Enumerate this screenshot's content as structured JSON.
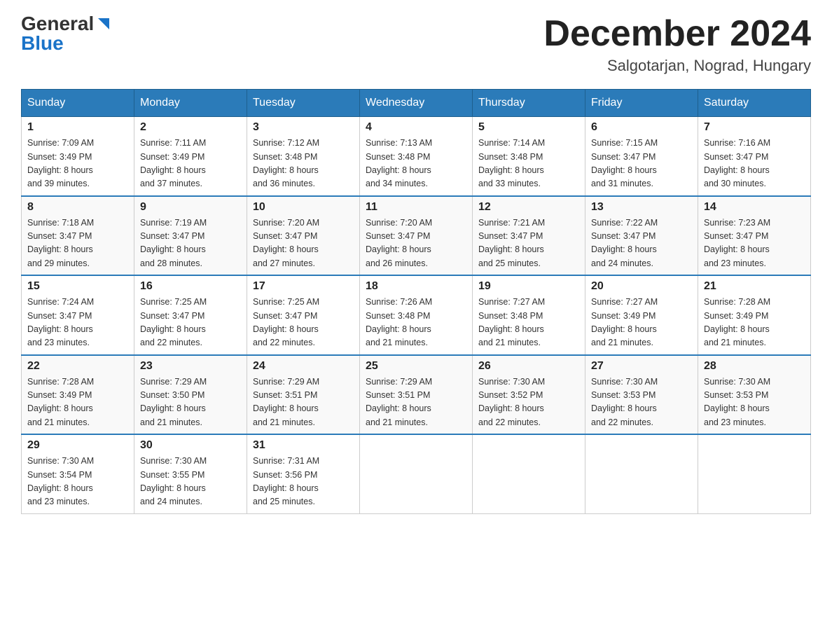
{
  "header": {
    "logo_general": "General",
    "logo_blue": "Blue",
    "month_title": "December 2024",
    "location": "Salgotarjan, Nograd, Hungary"
  },
  "weekdays": [
    "Sunday",
    "Monday",
    "Tuesday",
    "Wednesday",
    "Thursday",
    "Friday",
    "Saturday"
  ],
  "weeks": [
    [
      {
        "day": "1",
        "sunrise": "7:09 AM",
        "sunset": "3:49 PM",
        "daylight": "8 hours and 39 minutes."
      },
      {
        "day": "2",
        "sunrise": "7:11 AM",
        "sunset": "3:49 PM",
        "daylight": "8 hours and 37 minutes."
      },
      {
        "day": "3",
        "sunrise": "7:12 AM",
        "sunset": "3:48 PM",
        "daylight": "8 hours and 36 minutes."
      },
      {
        "day": "4",
        "sunrise": "7:13 AM",
        "sunset": "3:48 PM",
        "daylight": "8 hours and 34 minutes."
      },
      {
        "day": "5",
        "sunrise": "7:14 AM",
        "sunset": "3:48 PM",
        "daylight": "8 hours and 33 minutes."
      },
      {
        "day": "6",
        "sunrise": "7:15 AM",
        "sunset": "3:47 PM",
        "daylight": "8 hours and 31 minutes."
      },
      {
        "day": "7",
        "sunrise": "7:16 AM",
        "sunset": "3:47 PM",
        "daylight": "8 hours and 30 minutes."
      }
    ],
    [
      {
        "day": "8",
        "sunrise": "7:18 AM",
        "sunset": "3:47 PM",
        "daylight": "8 hours and 29 minutes."
      },
      {
        "day": "9",
        "sunrise": "7:19 AM",
        "sunset": "3:47 PM",
        "daylight": "8 hours and 28 minutes."
      },
      {
        "day": "10",
        "sunrise": "7:20 AM",
        "sunset": "3:47 PM",
        "daylight": "8 hours and 27 minutes."
      },
      {
        "day": "11",
        "sunrise": "7:20 AM",
        "sunset": "3:47 PM",
        "daylight": "8 hours and 26 minutes."
      },
      {
        "day": "12",
        "sunrise": "7:21 AM",
        "sunset": "3:47 PM",
        "daylight": "8 hours and 25 minutes."
      },
      {
        "day": "13",
        "sunrise": "7:22 AM",
        "sunset": "3:47 PM",
        "daylight": "8 hours and 24 minutes."
      },
      {
        "day": "14",
        "sunrise": "7:23 AM",
        "sunset": "3:47 PM",
        "daylight": "8 hours and 23 minutes."
      }
    ],
    [
      {
        "day": "15",
        "sunrise": "7:24 AM",
        "sunset": "3:47 PM",
        "daylight": "8 hours and 23 minutes."
      },
      {
        "day": "16",
        "sunrise": "7:25 AM",
        "sunset": "3:47 PM",
        "daylight": "8 hours and 22 minutes."
      },
      {
        "day": "17",
        "sunrise": "7:25 AM",
        "sunset": "3:47 PM",
        "daylight": "8 hours and 22 minutes."
      },
      {
        "day": "18",
        "sunrise": "7:26 AM",
        "sunset": "3:48 PM",
        "daylight": "8 hours and 21 minutes."
      },
      {
        "day": "19",
        "sunrise": "7:27 AM",
        "sunset": "3:48 PM",
        "daylight": "8 hours and 21 minutes."
      },
      {
        "day": "20",
        "sunrise": "7:27 AM",
        "sunset": "3:49 PM",
        "daylight": "8 hours and 21 minutes."
      },
      {
        "day": "21",
        "sunrise": "7:28 AM",
        "sunset": "3:49 PM",
        "daylight": "8 hours and 21 minutes."
      }
    ],
    [
      {
        "day": "22",
        "sunrise": "7:28 AM",
        "sunset": "3:49 PM",
        "daylight": "8 hours and 21 minutes."
      },
      {
        "day": "23",
        "sunrise": "7:29 AM",
        "sunset": "3:50 PM",
        "daylight": "8 hours and 21 minutes."
      },
      {
        "day": "24",
        "sunrise": "7:29 AM",
        "sunset": "3:51 PM",
        "daylight": "8 hours and 21 minutes."
      },
      {
        "day": "25",
        "sunrise": "7:29 AM",
        "sunset": "3:51 PM",
        "daylight": "8 hours and 21 minutes."
      },
      {
        "day": "26",
        "sunrise": "7:30 AM",
        "sunset": "3:52 PM",
        "daylight": "8 hours and 22 minutes."
      },
      {
        "day": "27",
        "sunrise": "7:30 AM",
        "sunset": "3:53 PM",
        "daylight": "8 hours and 22 minutes."
      },
      {
        "day": "28",
        "sunrise": "7:30 AM",
        "sunset": "3:53 PM",
        "daylight": "8 hours and 23 minutes."
      }
    ],
    [
      {
        "day": "29",
        "sunrise": "7:30 AM",
        "sunset": "3:54 PM",
        "daylight": "8 hours and 23 minutes."
      },
      {
        "day": "30",
        "sunrise": "7:30 AM",
        "sunset": "3:55 PM",
        "daylight": "8 hours and 24 minutes."
      },
      {
        "day": "31",
        "sunrise": "7:31 AM",
        "sunset": "3:56 PM",
        "daylight": "8 hours and 25 minutes."
      },
      null,
      null,
      null,
      null
    ]
  ],
  "labels": {
    "sunrise": "Sunrise:",
    "sunset": "Sunset:",
    "daylight": "Daylight:"
  }
}
